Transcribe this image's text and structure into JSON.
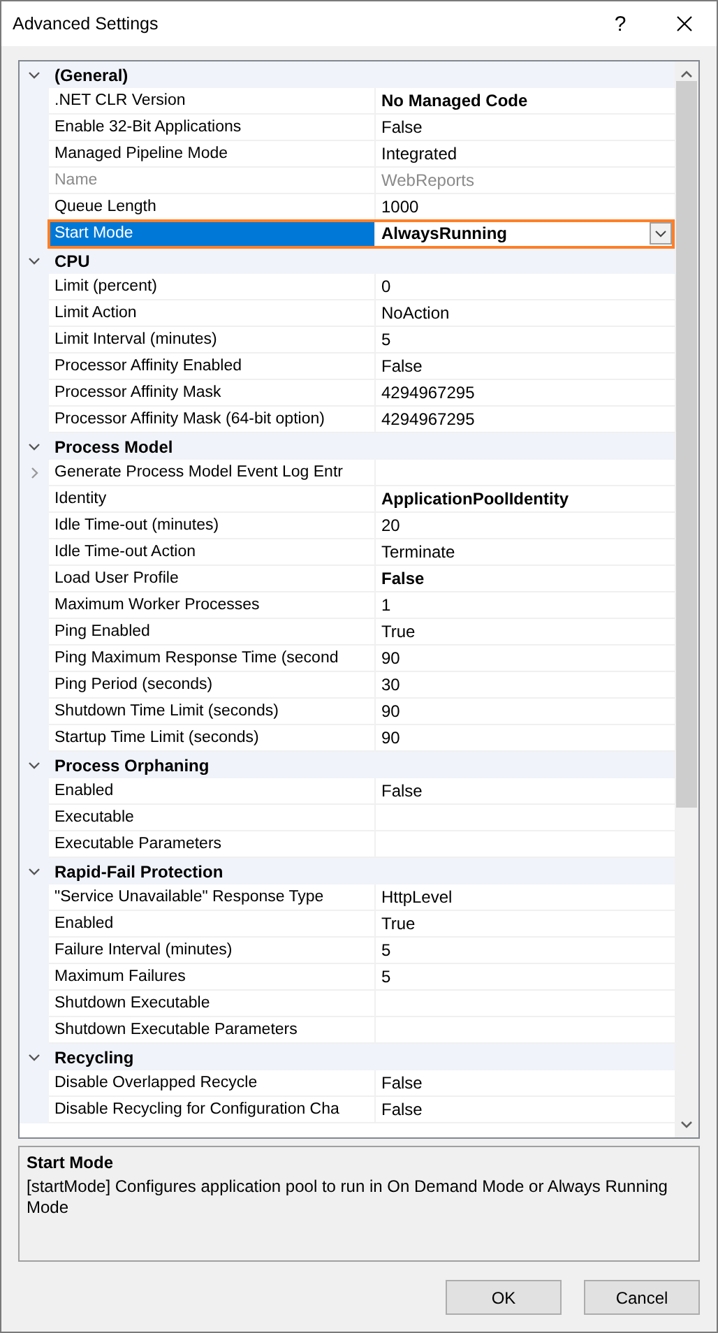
{
  "window": {
    "title": "Advanced Settings",
    "help_button": "?"
  },
  "categories": [
    {
      "title": "(General)",
      "expanded": true,
      "properties": [
        {
          "name": ".NET CLR Version",
          "value": "No Managed Code",
          "modified": true,
          "read_only": false,
          "selected": false
        },
        {
          "name": "Enable 32-Bit Applications",
          "value": "False",
          "modified": false,
          "read_only": false,
          "selected": false
        },
        {
          "name": "Managed Pipeline Mode",
          "value": "Integrated",
          "modified": false,
          "read_only": false,
          "selected": false
        },
        {
          "name": "Name",
          "value": "WebReports",
          "modified": false,
          "read_only": true,
          "selected": false
        },
        {
          "name": "Queue Length",
          "value": "1000",
          "modified": false,
          "read_only": false,
          "selected": false
        },
        {
          "name": "Start Mode",
          "value": "AlwaysRunning",
          "modified": true,
          "read_only": false,
          "selected": true
        }
      ]
    },
    {
      "title": "CPU",
      "expanded": true,
      "properties": [
        {
          "name": "Limit (percent)",
          "value": "0",
          "modified": false,
          "read_only": false,
          "selected": false
        },
        {
          "name": "Limit Action",
          "value": "NoAction",
          "modified": false,
          "read_only": false,
          "selected": false
        },
        {
          "name": "Limit Interval (minutes)",
          "value": "5",
          "modified": false,
          "read_only": false,
          "selected": false
        },
        {
          "name": "Processor Affinity Enabled",
          "value": "False",
          "modified": false,
          "read_only": false,
          "selected": false
        },
        {
          "name": "Processor Affinity Mask",
          "value": "4294967295",
          "modified": false,
          "read_only": false,
          "selected": false
        },
        {
          "name": "Processor Affinity Mask (64-bit option)",
          "value": "4294967295",
          "modified": false,
          "read_only": false,
          "selected": false
        }
      ]
    },
    {
      "title": "Process Model",
      "expanded": true,
      "properties": [
        {
          "name": "Generate Process Model Event Log Entr",
          "expanded": false,
          "read_only": false,
          "selected": false
        },
        {
          "name": "Identity",
          "value": "ApplicationPoolIdentity",
          "modified": true,
          "read_only": false,
          "selected": false
        },
        {
          "name": "Idle Time-out (minutes)",
          "value": "20",
          "modified": false,
          "read_only": false,
          "selected": false
        },
        {
          "name": "Idle Time-out Action",
          "value": "Terminate",
          "modified": false,
          "read_only": false,
          "selected": false
        },
        {
          "name": "Load User Profile",
          "value": "False",
          "modified": true,
          "read_only": false,
          "selected": false
        },
        {
          "name": "Maximum Worker Processes",
          "value": "1",
          "modified": false,
          "read_only": false,
          "selected": false
        },
        {
          "name": "Ping Enabled",
          "value": "True",
          "modified": false,
          "read_only": false,
          "selected": false
        },
        {
          "name": "Ping Maximum Response Time (second",
          "value": "90",
          "modified": false,
          "read_only": false,
          "selected": false
        },
        {
          "name": "Ping Period (seconds)",
          "value": "30",
          "modified": false,
          "read_only": false,
          "selected": false
        },
        {
          "name": "Shutdown Time Limit (seconds)",
          "value": "90",
          "modified": false,
          "read_only": false,
          "selected": false
        },
        {
          "name": "Startup Time Limit (seconds)",
          "value": "90",
          "modified": false,
          "read_only": false,
          "selected": false
        }
      ]
    },
    {
      "title": "Process Orphaning",
      "expanded": true,
      "properties": [
        {
          "name": "Enabled",
          "value": "False",
          "modified": false,
          "read_only": false,
          "selected": false
        },
        {
          "name": "Executable",
          "read_only": false,
          "selected": false
        },
        {
          "name": "Executable Parameters",
          "read_only": false,
          "selected": false
        }
      ]
    },
    {
      "title": "Rapid-Fail Protection",
      "expanded": true,
      "properties": [
        {
          "name": "\"Service Unavailable\" Response Type",
          "value": "HttpLevel",
          "modified": false,
          "read_only": false,
          "selected": false
        },
        {
          "name": "Enabled",
          "value": "True",
          "modified": false,
          "read_only": false,
          "selected": false
        },
        {
          "name": "Failure Interval (minutes)",
          "value": "5",
          "modified": false,
          "read_only": false,
          "selected": false
        },
        {
          "name": "Maximum Failures",
          "value": "5",
          "modified": false,
          "read_only": false,
          "selected": false
        },
        {
          "name": "Shutdown Executable",
          "read_only": false,
          "selected": false
        },
        {
          "name": "Shutdown Executable Parameters",
          "read_only": false,
          "selected": false
        }
      ]
    },
    {
      "title": "Recycling",
      "expanded": true,
      "properties": [
        {
          "name": "Disable Overlapped Recycle",
          "value": "False",
          "modified": false,
          "read_only": false,
          "selected": false
        },
        {
          "name": "Disable Recycling for Configuration Cha",
          "value": "False",
          "modified": false,
          "read_only": false,
          "selected": false
        }
      ]
    }
  ],
  "help": {
    "title": "Start Mode",
    "description": "[startMode] Configures application pool to run in On Demand Mode or Always Running Mode"
  },
  "buttons": [
    "OK",
    "Cancel"
  ]
}
